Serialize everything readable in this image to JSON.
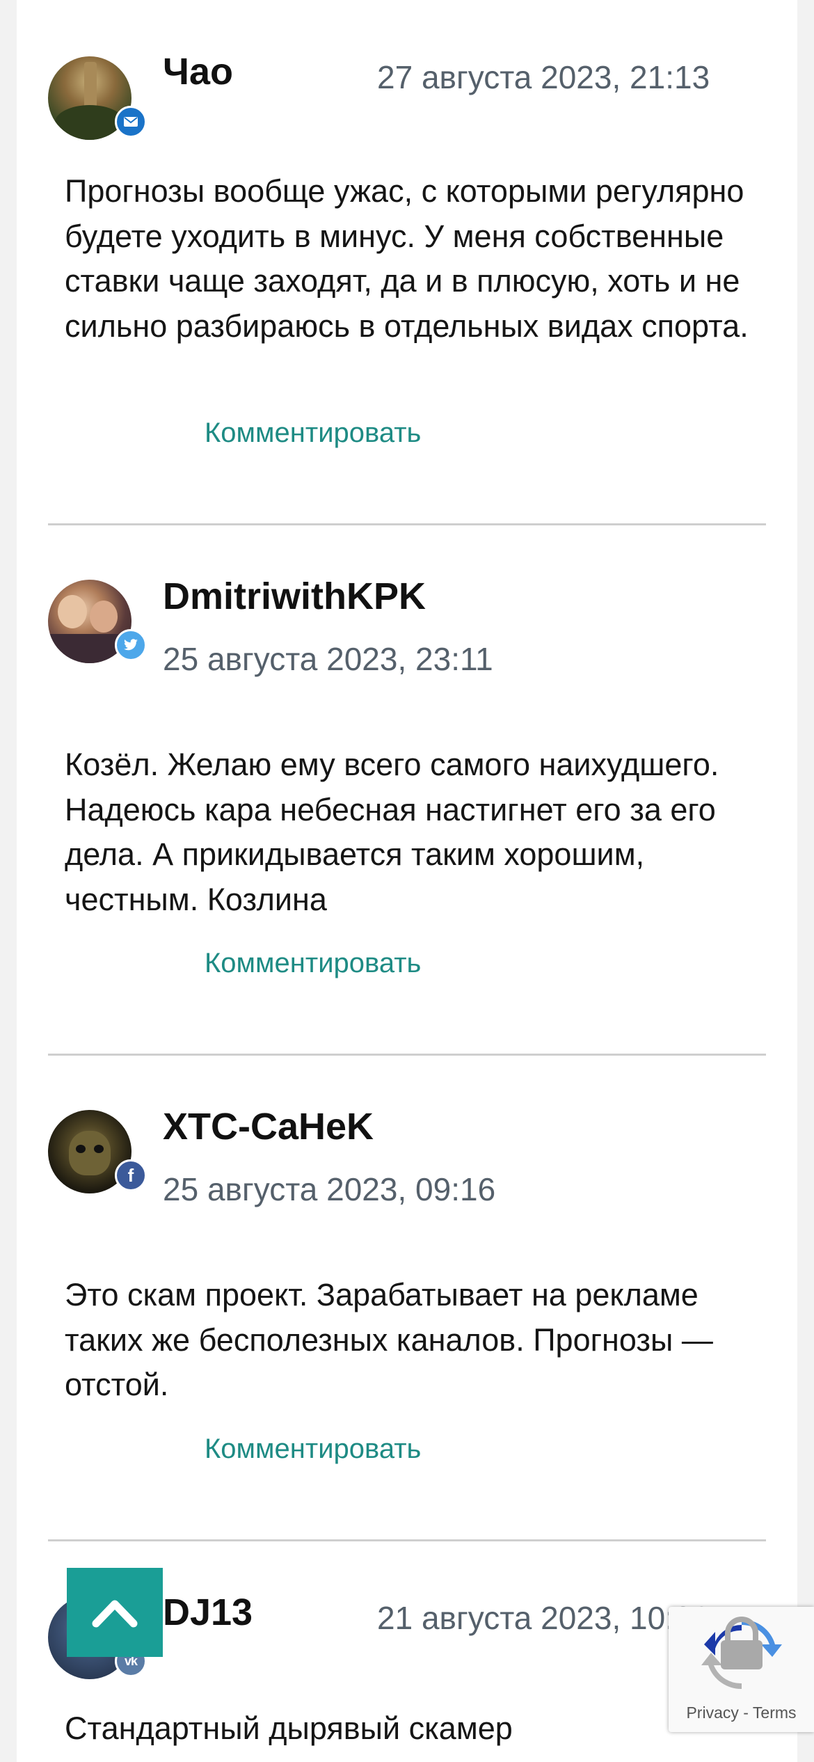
{
  "comments": [
    {
      "author": "Чао",
      "date": "27 августа 2023, 21:13",
      "text": "Прогнозы вообще ужас, с которыми регулярно будете уходить в минус. У меня собственные ставки чаще заходят, да и в плюсую, хоть и не сильно разбираюсь в отдельных видах спорта.",
      "reply_label": "Комментировать",
      "badge_icon": "mail-icon",
      "badge_color": "#1a73c8"
    },
    {
      "author": "DmitriwithKPK",
      "date": "25 августа 2023, 23:11",
      "text": "Козёл. Желаю ему всего самого наихудшего. Надеюсь кара небесная настигнет его за его дела. А прикидывается таким хорошим, честным. Козлина",
      "reply_label": "Комментировать",
      "badge_icon": "twitter-icon",
      "badge_color": "#4da7ea"
    },
    {
      "author": "XTC-CaHeK",
      "date": "25 августа 2023, 09:16",
      "text": "Это скам проект. Зарабатывает на рекламе таких же бесполезных каналов. Прогнозы — отстой.",
      "reply_label": "Комментировать",
      "badge_icon": "facebook-icon",
      "badge_color": "#3b5a9a"
    },
    {
      "author": "DJ13",
      "date": "21 августа 2023, 10:36",
      "text": "Стандартный дырявый скамер",
      "badge_icon": "vk-icon",
      "badge_color": "#5a7ca6"
    }
  ],
  "recaptcha": {
    "privacy": "Privacy",
    "separator": "-",
    "terms": "Terms"
  },
  "colors": {
    "accent": "#1a9e96",
    "link": "#1e8b84",
    "date": "#55606b"
  }
}
